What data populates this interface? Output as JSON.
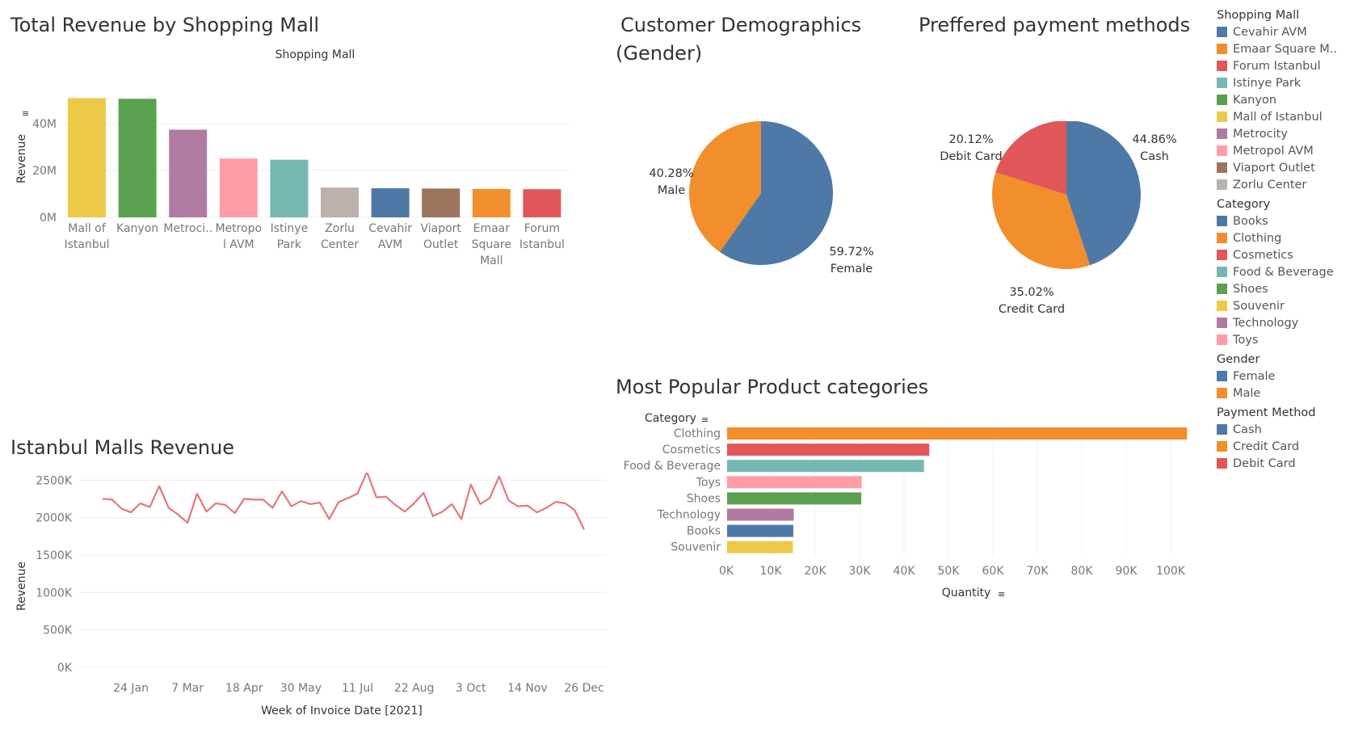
{
  "titles": {
    "mall_revenue": "Total Revenue by Shopping Mall",
    "gender_line1": "Customer Demographics",
    "gender_line2": "(Gender)",
    "payment": "Preffered payment methods",
    "line": "Istanbul Malls Revenue",
    "categories": "Most Popular Product categories"
  },
  "colors": {
    "blue": "#4E79A7",
    "orange": "#F28E2B",
    "red": "#E15759",
    "teal": "#76B7B2",
    "green": "#59A14F",
    "yellow": "#EDC948",
    "purple": "#B07AA1",
    "pink": "#FF9DA7",
    "brown": "#9C755F",
    "grey": "#BAB0AC",
    "line": "#E8757A"
  },
  "chart_data": [
    {
      "id": "mall_revenue",
      "type": "bar",
      "title": "Total Revenue by Shopping Mall",
      "header": "Shopping Mall",
      "ylabel": "Revenue",
      "ylim": [
        0,
        50000000
      ],
      "ytick_values": [
        0,
        20000000,
        40000000
      ],
      "ytick_labels": [
        "0M",
        "20M",
        "40M"
      ],
      "categories": [
        "Mall of Istanbul",
        "Kanyon",
        "Metrocity",
        "Metropol AVM",
        "Istinye Park",
        "Zorlu Center",
        "Cevahir AVM",
        "Viaport Outlet",
        "Emaar Square Mall",
        "Forum Istanbul"
      ],
      "category_labels": [
        [
          "Mall of",
          "Istanbul"
        ],
        [
          "Kanyon"
        ],
        [
          "Metroci.."
        ],
        [
          "Metropo",
          "l AVM"
        ],
        [
          "Istinye",
          "Park"
        ],
        [
          "Zorlu",
          "Center"
        ],
        [
          "Cevahir",
          "AVM"
        ],
        [
          "Viaport",
          "Outlet"
        ],
        [
          "Emaar",
          "Square",
          "Mall"
        ],
        [
          "Forum",
          "Istanbul"
        ]
      ],
      "values": [
        50900000,
        50600000,
        37400000,
        25100000,
        24600000,
        12700000,
        12400000,
        12300000,
        12100000,
        12000000
      ],
      "colors": [
        "#EDC948",
        "#59A14F",
        "#B07AA1",
        "#FF9DA7",
        "#76B7B2",
        "#BAB0AC",
        "#4E79A7",
        "#9C755F",
        "#F28E2B",
        "#E15759"
      ]
    },
    {
      "id": "gender",
      "type": "pie",
      "labels": [
        "Female",
        "Male"
      ],
      "values": [
        59.72,
        40.28
      ],
      "value_labels": [
        "59.72%",
        "40.28%"
      ],
      "colors": [
        "#4E79A7",
        "#F28E2B"
      ]
    },
    {
      "id": "payment",
      "type": "pie",
      "labels": [
        "Cash",
        "Credit Card",
        "Debit Card"
      ],
      "values": [
        44.86,
        35.02,
        20.12
      ],
      "value_labels": [
        "44.86%",
        "35.02%",
        "20.12%"
      ],
      "colors": [
        "#4E79A7",
        "#F28E2B",
        "#E15759"
      ]
    },
    {
      "id": "line",
      "type": "line",
      "title": "Istanbul Malls Revenue",
      "xlabel": "Week of Invoice Date [2021]",
      "ylabel": "Revenue",
      "ylim": [
        0,
        2600000
      ],
      "ytick_values": [
        0,
        500000,
        1000000,
        1500000,
        2000000,
        2500000
      ],
      "ytick_labels": [
        "0K",
        "500K",
        "1000K",
        "1500K",
        "2000K",
        "2500K"
      ],
      "xtick_labels": [
        "24 Jan",
        "7 Mar",
        "18 Apr",
        "30 May",
        "11 Jul",
        "22 Aug",
        "3 Oct",
        "14 Nov",
        "26 Dec"
      ],
      "values": [
        2250000,
        2240000,
        2120000,
        2070000,
        2190000,
        2140000,
        2420000,
        2130000,
        2040000,
        1930000,
        2320000,
        2080000,
        2190000,
        2170000,
        2060000,
        2250000,
        2240000,
        2240000,
        2130000,
        2350000,
        2150000,
        2220000,
        2180000,
        2200000,
        1980000,
        2210000,
        2260000,
        2320000,
        2610000,
        2270000,
        2280000,
        2170000,
        2080000,
        2190000,
        2330000,
        2020000,
        2080000,
        2180000,
        1980000,
        2440000,
        2180000,
        2260000,
        2550000,
        2230000,
        2150000,
        2160000,
        2070000,
        2130000,
        2210000,
        2190000,
        2100000,
        1840000
      ]
    },
    {
      "id": "categories",
      "type": "bar",
      "orientation": "horizontal",
      "title": "Most Popular Product categories",
      "ylabel": "Category",
      "xlabel": "Quantity",
      "xlim": [
        0,
        105000
      ],
      "xtick_values": [
        0,
        10000,
        20000,
        30000,
        40000,
        50000,
        60000,
        70000,
        80000,
        90000,
        100000
      ],
      "xtick_labels": [
        "0K",
        "10K",
        "20K",
        "30K",
        "40K",
        "50K",
        "60K",
        "70K",
        "80K",
        "90K",
        "100K"
      ],
      "categories": [
        "Clothing",
        "Cosmetics",
        "Food & Beverage",
        "Toys",
        "Shoes",
        "Technology",
        "Books",
        "Souvenir"
      ],
      "values": [
        103500,
        45500,
        44300,
        30300,
        30200,
        15000,
        14900,
        14800
      ],
      "colors": [
        "#F28E2B",
        "#E15759",
        "#76B7B2",
        "#FF9DA7",
        "#59A14F",
        "#B07AA1",
        "#4E79A7",
        "#EDC948"
      ]
    }
  ],
  "legend": [
    {
      "title": "Shopping Mall",
      "items": [
        {
          "label": "Cevahir AVM",
          "color": "#4E79A7"
        },
        {
          "label": "Emaar Square M..",
          "color": "#F28E2B"
        },
        {
          "label": "Forum Istanbul",
          "color": "#E15759"
        },
        {
          "label": "Istinye Park",
          "color": "#76B7B2"
        },
        {
          "label": "Kanyon",
          "color": "#59A14F"
        },
        {
          "label": "Mall of Istanbul",
          "color": "#EDC948"
        },
        {
          "label": "Metrocity",
          "color": "#B07AA1"
        },
        {
          "label": "Metropol AVM",
          "color": "#FF9DA7"
        },
        {
          "label": "Viaport Outlet",
          "color": "#9C755F"
        },
        {
          "label": "Zorlu Center",
          "color": "#BAB0AC"
        }
      ]
    },
    {
      "title": "Category",
      "items": [
        {
          "label": "Books",
          "color": "#4E79A7"
        },
        {
          "label": "Clothing",
          "color": "#F28E2B"
        },
        {
          "label": "Cosmetics",
          "color": "#E15759"
        },
        {
          "label": "Food & Beverage",
          "color": "#76B7B2"
        },
        {
          "label": "Shoes",
          "color": "#59A14F"
        },
        {
          "label": "Souvenir",
          "color": "#EDC948"
        },
        {
          "label": "Technology",
          "color": "#B07AA1"
        },
        {
          "label": "Toys",
          "color": "#FF9DA7"
        }
      ]
    },
    {
      "title": "Gender",
      "items": [
        {
          "label": "Female",
          "color": "#4E79A7"
        },
        {
          "label": "Male",
          "color": "#F28E2B"
        }
      ]
    },
    {
      "title": "Payment Method",
      "items": [
        {
          "label": "Cash",
          "color": "#4E79A7"
        },
        {
          "label": "Credit Card",
          "color": "#F28E2B"
        },
        {
          "label": "Debit Card",
          "color": "#E15759"
        }
      ]
    }
  ]
}
